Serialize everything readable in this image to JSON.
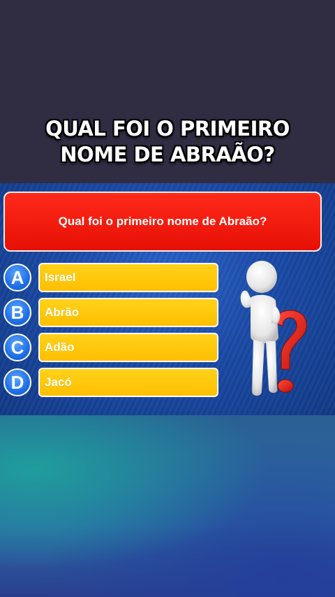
{
  "headline": {
    "line1": "QUAL FOI O PRIMEIRO",
    "line2": "NOME DE ABRAÃO?"
  },
  "quiz": {
    "question": "Qual foi o primeiro nome de Abraão?",
    "options": [
      {
        "letter": "A",
        "text": "Israel"
      },
      {
        "letter": "B",
        "text": "Abrão"
      },
      {
        "letter": "C",
        "text": "Adão"
      },
      {
        "letter": "D",
        "text": "Jacó"
      }
    ]
  },
  "colors": {
    "question_bg": "#ff1f10",
    "answer_bg": "#ffc800",
    "letter_bg": "#1f6fe6",
    "panel_bg": "#1b4aa6",
    "question_mark": "#e8231a"
  },
  "icons": {
    "figure": "thinking-person-icon",
    "question_mark": "question-mark-icon"
  }
}
